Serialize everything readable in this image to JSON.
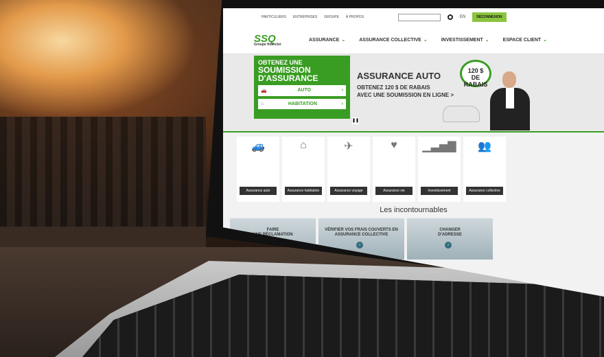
{
  "screen": {
    "topbar": {
      "links": [
        "PARTICULIERS",
        "ENTREPRISES",
        "GROUPE",
        "À PROPOS"
      ],
      "search_placeholder": "",
      "lang": "EN",
      "logout_label": "DÉCONNEXION"
    },
    "logo": {
      "text": "SSQ",
      "sub": "Groupe financier"
    },
    "nav": [
      {
        "label": "ASSURANCE"
      },
      {
        "label": "ASSURANCE COLLECTIVE"
      },
      {
        "label": "INVESTISSEMENT"
      },
      {
        "label": "ESPACE CLIENT"
      }
    ],
    "hero": {
      "quote_line1": "OBTENEZ UNE",
      "quote_line2": "SOUMISSION",
      "quote_line3": "D'ASSURANCE",
      "btn_auto": "AUTO",
      "btn_habitation": "HABITATION",
      "title": "ASSURANCE AUTO",
      "sub1": "OBTENEZ 120 $ DE RABAIS",
      "sub2": "AVEC UNE SOUMISSION EN LIGNE >",
      "badge_amount": "120 $",
      "badge_text": "DE RABAIS"
    },
    "cards": [
      {
        "label": "Assurance auto",
        "icon": "car-icon"
      },
      {
        "label": "Assurance habitation",
        "icon": "house-icon"
      },
      {
        "label": "Assurance voyage",
        "icon": "plane-icon"
      },
      {
        "label": "Assurance vie",
        "icon": "heart-icon"
      },
      {
        "label": "Investissement",
        "icon": "chart-icon"
      },
      {
        "label": "Assurance collective",
        "icon": "group-icon"
      }
    ],
    "section_title": "Les incontournables",
    "tiles": [
      {
        "line1": "FAIRE",
        "line2": "UNE RÉCLAMATION"
      },
      {
        "line1": "VÉRIFIER VOS FRAIS COUVERTS EN",
        "line2": "ASSURANCE COLLECTIVE"
      },
      {
        "line1": "CHANGER",
        "line2": "D'ADRESSE"
      }
    ]
  },
  "colors": {
    "brand_green": "#3a9d23",
    "lime": "#8bc53f"
  }
}
